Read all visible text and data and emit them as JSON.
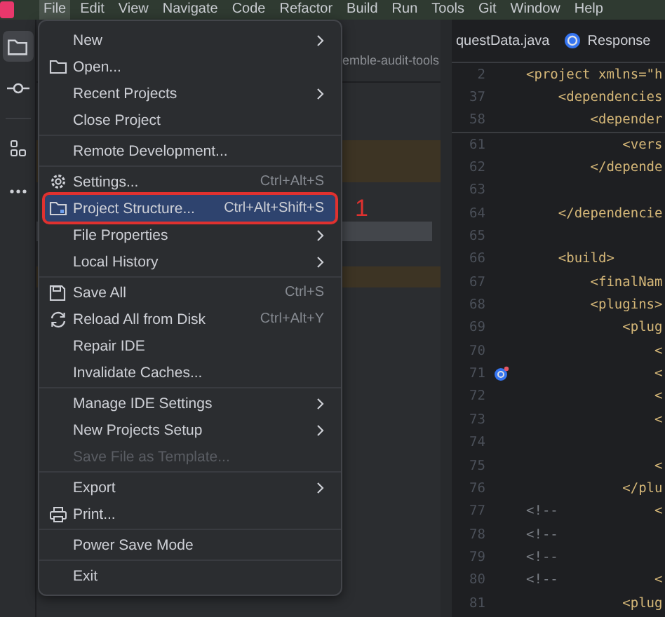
{
  "menu_bar": {
    "items": [
      {
        "label": "File",
        "selected": true
      },
      {
        "label": "Edit",
        "selected": false
      },
      {
        "label": "View",
        "selected": false
      },
      {
        "label": "Navigate",
        "selected": false
      },
      {
        "label": "Code",
        "selected": false
      },
      {
        "label": "Refactor",
        "selected": false
      },
      {
        "label": "Build",
        "selected": false
      },
      {
        "label": "Run",
        "selected": false
      },
      {
        "label": "Tools",
        "selected": false
      },
      {
        "label": "Git",
        "selected": false
      },
      {
        "label": "Window",
        "selected": false
      },
      {
        "label": "Help",
        "selected": false
      }
    ]
  },
  "tool_strip": [
    {
      "selected": true
    },
    {
      "selected": false
    },
    {
      "selected": false
    },
    {
      "selected": false
    }
  ],
  "project_panel": {
    "title": "emble-audit-tools"
  },
  "editor": {
    "tabs": [
      {
        "label": "questData.java"
      },
      {
        "label": "Response"
      }
    ],
    "lines": [
      {
        "number": "2",
        "code": [
          {
            "kind": "tag",
            "text": "<project xmlns=\"h"
          }
        ]
      },
      {
        "number": "37",
        "code": [
          {
            "kind": "tag",
            "text": "    <dependencies"
          }
        ]
      },
      {
        "number": "58",
        "code": [
          {
            "kind": "tag",
            "text": "        <depender"
          }
        ]
      },
      {
        "number": "61",
        "code": [
          {
            "kind": "tag",
            "text": "            <vers"
          }
        ]
      },
      {
        "number": "62",
        "code": [
          {
            "kind": "tag",
            "text": "        </depende"
          }
        ]
      },
      {
        "number": "63"
      },
      {
        "number": "64",
        "code": [
          {
            "kind": "tag",
            "text": "    </dependencie"
          }
        ]
      },
      {
        "number": "65"
      },
      {
        "number": "66",
        "code": [
          {
            "kind": "tag",
            "text": "    <build>"
          }
        ]
      },
      {
        "number": "67",
        "code": [
          {
            "kind": "tag",
            "text": "        <finalNam"
          }
        ]
      },
      {
        "number": "68",
        "code": [
          {
            "kind": "tag",
            "text": "        <plugins>"
          }
        ]
      },
      {
        "number": "69",
        "code": [
          {
            "kind": "tag",
            "text": "            <plug"
          }
        ]
      },
      {
        "number": "70",
        "code": [
          {
            "kind": "tag",
            "text": "                <"
          }
        ]
      },
      {
        "number": "71",
        "code": [
          {
            "kind": "tag",
            "text": "                <"
          }
        ]
      },
      {
        "number": "72",
        "code": [
          {
            "kind": "tag",
            "text": "                <"
          }
        ]
      },
      {
        "number": "73",
        "code": [
          {
            "kind": "tag",
            "text": "                <"
          }
        ]
      },
      {
        "number": "74"
      },
      {
        "number": "75",
        "code": [
          {
            "kind": "tag",
            "text": "                <"
          }
        ]
      },
      {
        "number": "76",
        "code": [
          {
            "kind": "tag",
            "text": "            </plu"
          }
        ]
      },
      {
        "number": "77",
        "code": [
          {
            "kind": "comment",
            "text": "<!--"
          },
          {
            "kind": "tag",
            "text": "            <"
          }
        ]
      },
      {
        "number": "78",
        "code": [
          {
            "kind": "comment",
            "text": "<!--"
          }
        ]
      },
      {
        "number": "79",
        "code": [
          {
            "kind": "comment",
            "text": "<!--"
          }
        ]
      },
      {
        "number": "80",
        "code": [
          {
            "kind": "comment",
            "text": "<!--"
          },
          {
            "kind": "tag",
            "text": "            <"
          }
        ]
      },
      {
        "number": "81",
        "code": [
          {
            "kind": "tag",
            "text": "            <plug"
          }
        ]
      }
    ]
  },
  "file_menu": {
    "items": [
      {
        "kind": "item",
        "label": "New",
        "submenu": true,
        "selected": false,
        "disabled": false
      },
      {
        "kind": "item",
        "label": "Open...",
        "submenu": false,
        "selected": false,
        "disabled": false
      },
      {
        "kind": "item",
        "label": "Recent Projects",
        "submenu": true,
        "selected": false,
        "disabled": false
      },
      {
        "kind": "item",
        "label": "Close Project",
        "submenu": false,
        "selected": false,
        "disabled": false
      },
      {
        "kind": "separator"
      },
      {
        "kind": "item",
        "label": "Remote Development...",
        "submenu": false,
        "selected": false,
        "disabled": false
      },
      {
        "kind": "separator"
      },
      {
        "kind": "item",
        "label": "Settings...",
        "shortcut": "Ctrl+Alt+S",
        "submenu": false,
        "selected": false,
        "disabled": false
      },
      {
        "kind": "item",
        "label": "Project Structure...",
        "shortcut": "Ctrl+Alt+Shift+S",
        "submenu": false,
        "selected": true,
        "disabled": false
      },
      {
        "kind": "item",
        "label": "File Properties",
        "submenu": true,
        "selected": false,
        "disabled": false
      },
      {
        "kind": "item",
        "label": "Local History",
        "submenu": true,
        "selected": false,
        "disabled": false
      },
      {
        "kind": "separator"
      },
      {
        "kind": "item",
        "label": "Save All",
        "shortcut": "Ctrl+S",
        "submenu": false,
        "selected": false,
        "disabled": false
      },
      {
        "kind": "item",
        "label": "Reload All from Disk",
        "shortcut": "Ctrl+Alt+Y",
        "submenu": false,
        "selected": false,
        "disabled": false
      },
      {
        "kind": "item",
        "label": "Repair IDE",
        "submenu": false,
        "selected": false,
        "disabled": false
      },
      {
        "kind": "item",
        "label": "Invalidate Caches...",
        "submenu": false,
        "selected": false,
        "disabled": false
      },
      {
        "kind": "separator"
      },
      {
        "kind": "item",
        "label": "Manage IDE Settings",
        "submenu": true,
        "selected": false,
        "disabled": false
      },
      {
        "kind": "item",
        "label": "New Projects Setup",
        "submenu": true,
        "selected": false,
        "disabled": false
      },
      {
        "kind": "item",
        "label": "Save File as Template...",
        "submenu": false,
        "selected": false,
        "disabled": true
      },
      {
        "kind": "separator"
      },
      {
        "kind": "item",
        "label": "Export",
        "submenu": true,
        "selected": false,
        "disabled": false
      },
      {
        "kind": "item",
        "label": "Print...",
        "submenu": false,
        "selected": false,
        "disabled": false
      },
      {
        "kind": "separator"
      },
      {
        "kind": "item",
        "label": "Power Save Mode",
        "submenu": false,
        "selected": false,
        "disabled": false
      },
      {
        "kind": "separator"
      },
      {
        "kind": "item",
        "label": "Exit",
        "submenu": false,
        "selected": false,
        "disabled": false
      }
    ],
    "annotation": {
      "label": "1"
    }
  }
}
